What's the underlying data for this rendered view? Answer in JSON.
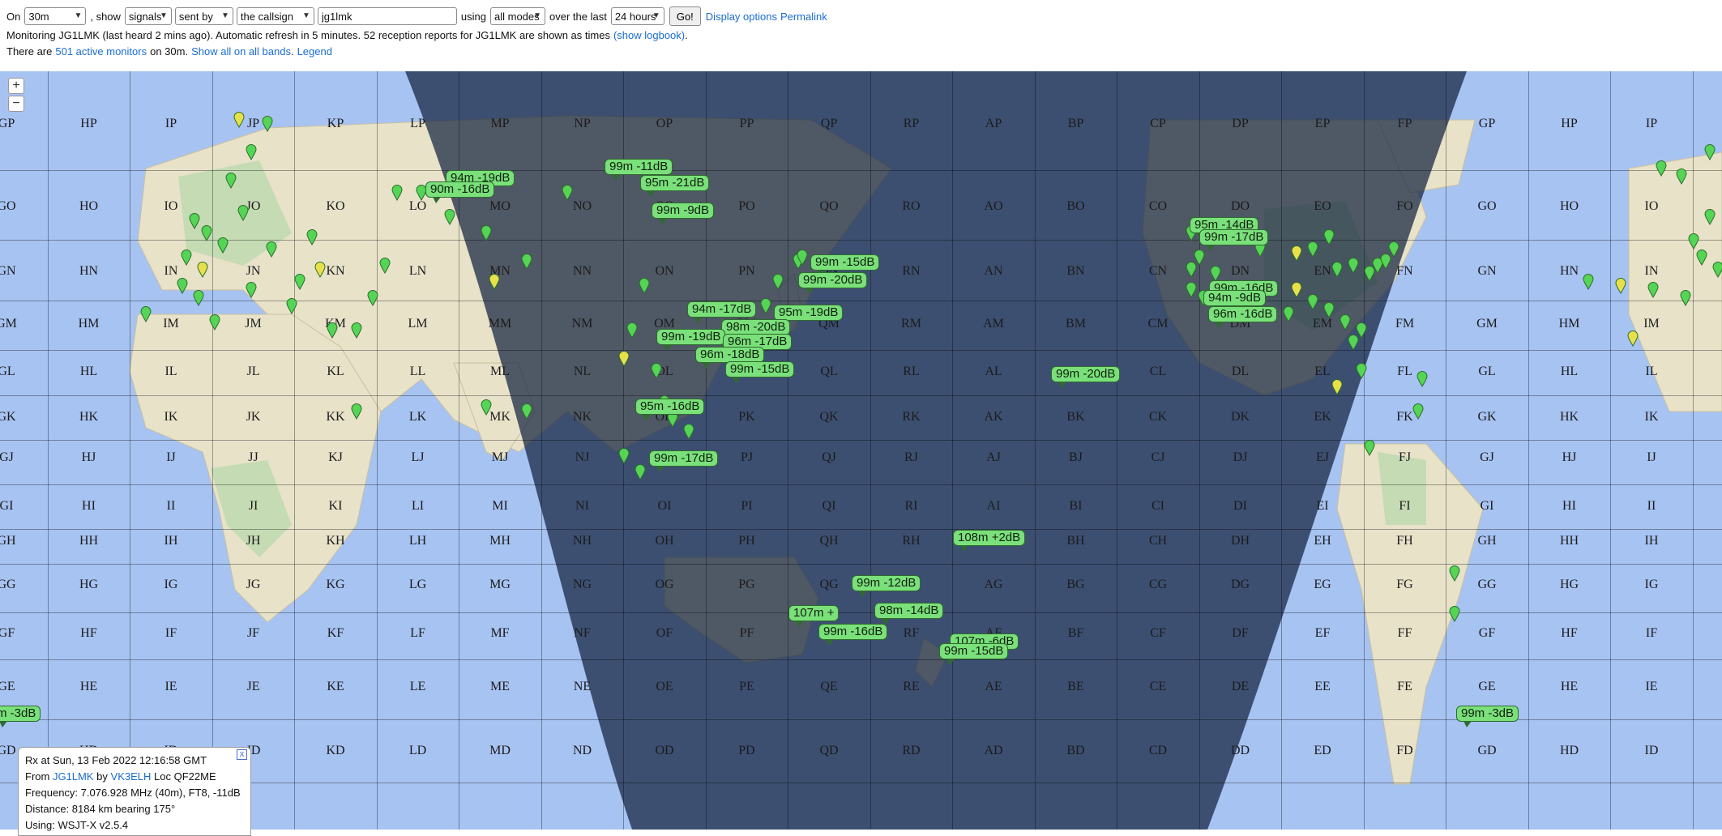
{
  "controls": {
    "on_label": "On",
    "band_value": "30m",
    "show_label": ", show",
    "show_value": "signals",
    "direction_value": "sent by",
    "target_value": "the callsign",
    "callsign_value": "jg1lmk",
    "using_label": "using",
    "modes_value": "all modes",
    "over_label": "over the last",
    "period_value": "24 hours",
    "go_label": "Go!",
    "display_options_label": "Display options",
    "permalink_label": "Permalink"
  },
  "status": {
    "monitoring_text": "Monitoring JG1LMK (last heard 2 mins ago). Automatic refresh in 5 minutes. 52 reception reports for JG1LMK are shown as times",
    "logbook_link": "(show logbook)",
    "logbook_suffix": ".",
    "there_are": "There are",
    "active_monitors_link": "501 active monitors",
    "on_band": "on 30m.",
    "show_all_link": "Show all on all bands",
    "legend_link": "Legend",
    "period_after_show_all": "."
  },
  "map": {
    "zoom_in": "+",
    "zoom_out": "−",
    "columns": [
      "GP",
      "HP",
      "IP",
      "JP",
      "KP",
      "LP",
      "MP",
      "NP",
      "OP",
      "PP",
      "QP",
      "RP",
      "AP",
      "BP",
      "CP",
      "DP",
      "EP",
      "FP",
      "GP",
      "HP",
      "IP",
      "JP"
    ],
    "rows": [
      {
        "suffix": "P"
      },
      {
        "suffix": "O"
      },
      {
        "suffix": "N"
      },
      {
        "suffix": "M"
      },
      {
        "suffix": "L"
      },
      {
        "suffix": "K"
      },
      {
        "suffix": "J"
      },
      {
        "suffix": "I"
      },
      {
        "suffix": "H"
      },
      {
        "suffix": "G"
      },
      {
        "suffix": "F"
      },
      {
        "suffix": "E"
      },
      {
        "suffix": "D"
      }
    ],
    "grid_prefixes": [
      "G",
      "H",
      "I",
      "J",
      "K",
      "L",
      "M",
      "N",
      "O",
      "P",
      "Q",
      "R",
      "A",
      "B",
      "C",
      "D",
      "E",
      "F",
      "G",
      "H",
      "I",
      "J"
    ],
    "reports": [
      {
        "text": "99m -11dB"
      },
      {
        "text": "95m -21dB"
      },
      {
        "text": "99m -9dB"
      },
      {
        "text": "94m -19dB"
      },
      {
        "text": "90m -16dB"
      },
      {
        "text": "99m -15dB"
      },
      {
        "text": "99m -20dB"
      },
      {
        "text": "94m -17dB"
      },
      {
        "text": "95m -19dB"
      },
      {
        "text": "98m -20dB"
      },
      {
        "text": "99m -19dB"
      },
      {
        "text": "96m -17dB"
      },
      {
        "text": "96m -18dB"
      },
      {
        "text": "99m -15dB"
      },
      {
        "text": "95m -16dB"
      },
      {
        "text": "99m -17dB"
      },
      {
        "text": "99m -20dB"
      },
      {
        "text": "108m +2dB"
      },
      {
        "text": "99m -12dB"
      },
      {
        "text": "107m +"
      },
      {
        "text": "98m -14dB"
      },
      {
        "text": "99m -16dB"
      },
      {
        "text": "107m -6dB"
      },
      {
        "text": "99m -15dB"
      },
      {
        "text": "95m -14dB"
      },
      {
        "text": "99m -17dB"
      },
      {
        "text": "99m -16dB"
      },
      {
        "text": "94m -9dB"
      },
      {
        "text": "96m -16dB"
      },
      {
        "text": "99m -3dB"
      },
      {
        "text": "m -3dB"
      }
    ],
    "marker_colors": {
      "green": "#55d455",
      "outline": "#2a6e2a",
      "yellow": "#e8e04a",
      "blue": "#4a5fd4",
      "red": "#d44a4a",
      "purple": "#b04ad4"
    }
  },
  "info": {
    "line1": "Rx at Sun, 13 Feb 2022 12:16:58 GMT",
    "from_label": "From",
    "from_call": "JG1LMK",
    "by_label": "by",
    "by_call": "VK3ELH",
    "loc_text": "Loc QF22ME",
    "line3": "Frequency: 7.076.928 MHz (40m), FT8, -11dB",
    "line4": "Distance: 8184 km bearing 175°",
    "line5": "Using: WSJT-X v2.5.4",
    "close": "x"
  }
}
